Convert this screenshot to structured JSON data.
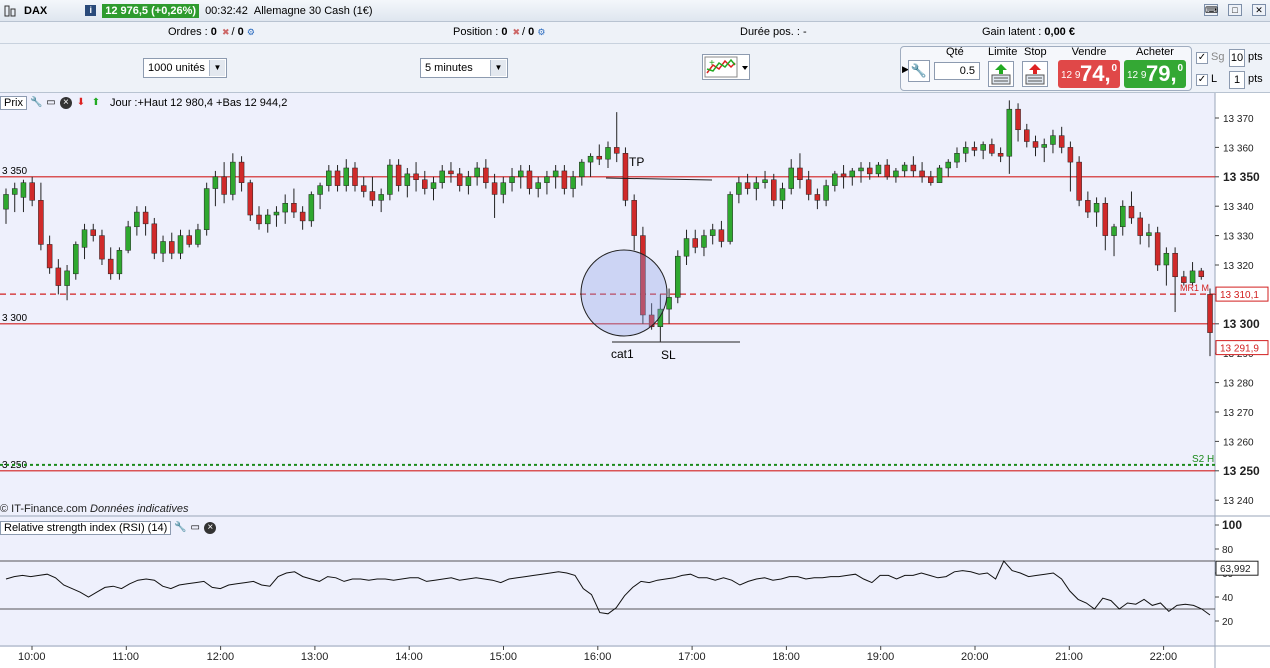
{
  "titlebar": {
    "symbol": "DAX",
    "info_icon": "i",
    "price_change": "12 976,5 (+0,26%)",
    "clock": "00:32:42",
    "instrument": "Allemagne 30 Cash (1€)",
    "buttons": [
      "keyboard-icon",
      "close-icon",
      "maximize-icon"
    ]
  },
  "status": {
    "orders_label": "Ordres :",
    "orders_count": "0",
    "orders_count2": "0",
    "position_label": "Position :",
    "position_count": "0",
    "position_count2": "0",
    "duration_label": "Durée pos. :",
    "duration_value": "-",
    "gain_label": "Gain latent :",
    "gain_value": "0,00 €"
  },
  "toolbar": {
    "units_select": "1000 unités",
    "timeframe_select": "5 minutes",
    "qty_label": "Qté",
    "qty_value": "0.5",
    "limit_label": "Limite",
    "stop_label": "Stop",
    "sell_label": "Vendre",
    "buy_label": "Acheter",
    "sell_small": "12 9",
    "sell_big": "74,",
    "sell_sup": "0",
    "buy_small": "12 9",
    "buy_big": "79,",
    "buy_sup": "0",
    "sg_label": "Sg",
    "sg_pts": "10",
    "l_label": "L",
    "l_pts": "1",
    "pts_label": "pts"
  },
  "chart_header": {
    "label": "Prix",
    "stats": "Jour :+Haut 12 980,4 +Bas 12 944,2"
  },
  "watermark": {
    "source": "© IT-Finance.com",
    "note": "Données indicatives"
  },
  "rsi_header": {
    "title": "Relative strength index (RSI) (14)"
  },
  "chart_data": [
    {
      "type": "candlestick",
      "price_axis": {
        "min": 13240,
        "max": 13370,
        "ticks": [
          "13 370",
          "13 360",
          "13 350",
          "13 340",
          "13 330",
          "13 320",
          "13 310",
          "13 300",
          "13 290",
          "13 280",
          "13 270",
          "13 260",
          "13 250",
          "13 240"
        ]
      },
      "time_axis": [
        "10:00",
        "11:00",
        "12:00",
        "13:00",
        "14:00",
        "15:00",
        "16:00",
        "17:00",
        "18:00",
        "19:00",
        "20:00",
        "21:00",
        "22:00"
      ],
      "horizontal_lines": [
        {
          "price": 13350,
          "label": "3 350",
          "style": "solid",
          "color": "#d21f1f"
        },
        {
          "price": 13300,
          "label": "3 300",
          "style": "solid",
          "color": "#d21f1f"
        },
        {
          "price": 13250,
          "label": "3 250",
          "style": "solid",
          "color": "#d21f1f"
        },
        {
          "price": 13310.1,
          "label": "",
          "style": "dashed",
          "color": "#d21f1f"
        },
        {
          "price": 13252,
          "label": "S2 H",
          "style": "dotted",
          "color": "#1b8a1b"
        }
      ],
      "axis_badges": [
        {
          "text": "13 310,1",
          "color": "#d21f1f"
        },
        {
          "text": "13 291,9",
          "color": "#d21f1f"
        }
      ],
      "bold_ticks": [
        "13 350",
        "13 300",
        "13 250"
      ],
      "annotations": [
        "TP",
        "cat1",
        "SL",
        "MR1 M"
      ],
      "candles": [
        [
          13339,
          13346,
          13334,
          13344
        ],
        [
          13344,
          13348,
          13338,
          13346
        ],
        [
          13343,
          13349,
          13338,
          13348
        ],
        [
          13348,
          13350,
          13340,
          13342
        ],
        [
          13342,
          13348,
          13325,
          13327
        ],
        [
          13327,
          13330,
          13317,
          13319
        ],
        [
          13319,
          13322,
          13310,
          13313
        ],
        [
          13313,
          13320,
          13308,
          13318
        ],
        [
          13317,
          13328,
          13315,
          13327
        ],
        [
          13326,
          13334,
          13322,
          13332
        ],
        [
          13332,
          13334,
          13328,
          13330
        ],
        [
          13330,
          13332,
          13320,
          13322
        ],
        [
          13322,
          13326,
          13315,
          13317
        ],
        [
          13317,
          13326,
          13315,
          13325
        ],
        [
          13325,
          13335,
          13324,
          13333
        ],
        [
          13333,
          13340,
          13330,
          13338
        ],
        [
          13338,
          13340,
          13330,
          13334
        ],
        [
          13334,
          13336,
          13322,
          13324
        ],
        [
          13324,
          13330,
          13321,
          13328
        ],
        [
          13328,
          13331,
          13322,
          13324
        ],
        [
          13324,
          13332,
          13322,
          13330
        ],
        [
          13330,
          13332,
          13326,
          13327
        ],
        [
          13327,
          13334,
          13326,
          13332
        ],
        [
          13332,
          13348,
          13330,
          13346
        ],
        [
          13346,
          13352,
          13340,
          13350
        ],
        [
          13350,
          13355,
          13341,
          13344
        ],
        [
          13344,
          13358,
          13342,
          13355
        ],
        [
          13355,
          13357,
          13345,
          13348
        ],
        [
          13348,
          13349,
          13335,
          13337
        ],
        [
          13337,
          13340,
          13332,
          13334
        ],
        [
          13334,
          13339,
          13331,
          13337
        ],
        [
          13337,
          13340,
          13333,
          13338
        ],
        [
          13338,
          13344,
          13334,
          13341
        ],
        [
          13341,
          13346,
          13336,
          13338
        ],
        [
          13338,
          13340,
          13332,
          13335
        ],
        [
          13335,
          13345,
          13333,
          13344
        ],
        [
          13344,
          13348,
          13339,
          13347
        ],
        [
          13347,
          13354,
          13345,
          13352
        ],
        [
          13352,
          13354,
          13345,
          13347
        ],
        [
          13347,
          13356,
          13345,
          13353
        ],
        [
          13353,
          13355,
          13345,
          13347
        ],
        [
          13347,
          13350,
          13343,
          13345
        ],
        [
          13345,
          13350,
          13340,
          13342
        ],
        [
          13342,
          13346,
          13338,
          13344
        ],
        [
          13344,
          13356,
          13342,
          13354
        ],
        [
          13354,
          13356,
          13345,
          13347
        ],
        [
          13347,
          13353,
          13343,
          13351
        ],
        [
          13351,
          13355,
          13345,
          13349
        ],
        [
          13349,
          13352,
          13344,
          13346
        ],
        [
          13346,
          13350,
          13342,
          13348
        ],
        [
          13348,
          13354,
          13346,
          13352
        ],
        [
          13352,
          13355,
          13348,
          13351
        ],
        [
          13351,
          13353,
          13345,
          13347
        ],
        [
          13347,
          13352,
          13344,
          13350
        ],
        [
          13350,
          13355,
          13347,
          13353
        ],
        [
          13353,
          13356,
          13346,
          13348
        ],
        [
          13348,
          13351,
          13336,
          13344
        ],
        [
          13344,
          13350,
          13341,
          13348
        ],
        [
          13348,
          13353,
          13345,
          13350
        ],
        [
          13350,
          13354,
          13346,
          13352
        ],
        [
          13352,
          13354,
          13344,
          13346
        ],
        [
          13346,
          13350,
          13343,
          13348
        ],
        [
          13348,
          13352,
          13344,
          13350
        ],
        [
          13350,
          13354,
          13346,
          13352
        ],
        [
          13352,
          13354,
          13344,
          13346
        ],
        [
          13346,
          13352,
          13343,
          13350
        ],
        [
          13350,
          13356,
          13347,
          13355
        ],
        [
          13355,
          13358,
          13350,
          13357
        ],
        [
          13357,
          13361,
          13354,
          13356
        ],
        [
          13356,
          13362,
          13353,
          13360
        ],
        [
          13360,
          13372,
          13355,
          13358
        ],
        [
          13358,
          13360,
          13340,
          13342
        ],
        [
          13342,
          13344,
          13325,
          13330
        ],
        [
          13330,
          13333,
          13300,
          13303
        ],
        [
          13303,
          13307,
          13298,
          13299
        ],
        [
          13299,
          13310,
          13294,
          13305
        ],
        [
          13305,
          13312,
          13300,
          13309
        ],
        [
          13309,
          13325,
          13307,
          13323
        ],
        [
          13323,
          13332,
          13320,
          13329
        ],
        [
          13329,
          13332,
          13324,
          13326
        ],
        [
          13326,
          13332,
          13323,
          13330
        ],
        [
          13330,
          13334,
          13327,
          13332
        ],
        [
          13332,
          13335,
          13326,
          13328
        ],
        [
          13328,
          13345,
          13327,
          13344
        ],
        [
          13344,
          13350,
          13341,
          13348
        ],
        [
          13348,
          13351,
          13344,
          13346
        ],
        [
          13346,
          13350,
          13342,
          13348
        ],
        [
          13348,
          13352,
          13346,
          13349
        ],
        [
          13349,
          13351,
          13340,
          13342
        ],
        [
          13342,
          13348,
          13339,
          13346
        ],
        [
          13346,
          13356,
          13344,
          13353
        ],
        [
          13353,
          13358,
          13346,
          13349
        ],
        [
          13349,
          13352,
          13342,
          13344
        ],
        [
          13344,
          13346,
          13339,
          13342
        ],
        [
          13342,
          13349,
          13340,
          13347
        ],
        [
          13347,
          13352,
          13345,
          13351
        ],
        [
          13351,
          13354,
          13346,
          13350
        ],
        [
          13350,
          13353,
          13347,
          13352
        ],
        [
          13352,
          13355,
          13348,
          13353
        ],
        [
          13353,
          13355,
          13349,
          13351
        ],
        [
          13351,
          13355,
          13350,
          13354
        ],
        [
          13354,
          13356,
          13349,
          13350
        ],
        [
          13350,
          13353,
          13348,
          13352
        ],
        [
          13352,
          13355,
          13350,
          13354
        ],
        [
          13354,
          13357,
          13350,
          13352
        ],
        [
          13352,
          13355,
          13348,
          13350
        ],
        [
          13350,
          13352,
          13347,
          13348
        ],
        [
          13348,
          13354,
          13348,
          13353
        ],
        [
          13353,
          13356,
          13350,
          13355
        ],
        [
          13355,
          13360,
          13353,
          13358
        ],
        [
          13358,
          13362,
          13355,
          13360
        ],
        [
          13360,
          13362,
          13357,
          13359
        ],
        [
          13359,
          13362,
          13356,
          13361
        ],
        [
          13361,
          13363,
          13357,
          13358
        ],
        [
          13358,
          13360,
          13355,
          13357
        ],
        [
          13357,
          13376,
          13351,
          13373
        ],
        [
          13373,
          13375,
          13362,
          13366
        ],
        [
          13366,
          13368,
          13360,
          13362
        ],
        [
          13362,
          13364,
          13357,
          13360
        ],
        [
          13360,
          13363,
          13355,
          13361
        ],
        [
          13361,
          13366,
          13358,
          13364
        ],
        [
          13364,
          13367,
          13358,
          13360
        ],
        [
          13360,
          13362,
          13345,
          13355
        ],
        [
          13355,
          13357,
          13340,
          13342
        ],
        [
          13342,
          13345,
          13336,
          13338
        ],
        [
          13338,
          13343,
          13333,
          13341
        ],
        [
          13341,
          13343,
          13325,
          13330
        ],
        [
          13330,
          13334,
          13323,
          13333
        ],
        [
          13333,
          13342,
          13330,
          13340
        ],
        [
          13340,
          13345,
          13334,
          13336
        ],
        [
          13336,
          13338,
          13327,
          13330
        ],
        [
          13330,
          13334,
          13326,
          13331
        ],
        [
          13331,
          13333,
          13318,
          13320
        ],
        [
          13320,
          13326,
          13313,
          13324
        ],
        [
          13324,
          13326,
          13304,
          13316
        ],
        [
          13316,
          13318,
          13313,
          13314
        ],
        [
          13314,
          13321,
          13313,
          13318
        ],
        [
          13318,
          13319,
          13315,
          13316
        ],
        [
          13310,
          13312,
          13289,
          13297
        ]
      ]
    },
    {
      "type": "line",
      "name": "Relative strength index (RSI) (14)",
      "y_axis": {
        "min": 0,
        "max": 100,
        "ticks": [
          "100",
          "80",
          "60",
          "40",
          "20"
        ]
      },
      "reference_lines": [
        70,
        30
      ],
      "last_value_badge": "63,992",
      "values": [
        55,
        57,
        58,
        57,
        58,
        59,
        56,
        50,
        47,
        44,
        40,
        44,
        48,
        49,
        47,
        51,
        54,
        55,
        54,
        49,
        47,
        50,
        51,
        52,
        53,
        48,
        47,
        50,
        51,
        52,
        53,
        50,
        49,
        57,
        60,
        61,
        57,
        55,
        53,
        57,
        56,
        53,
        55,
        55,
        54,
        55,
        55,
        54,
        55,
        56,
        56,
        53,
        54,
        55,
        56,
        54,
        55,
        56,
        55,
        54,
        52,
        55,
        56,
        57,
        58,
        59,
        60,
        61,
        60,
        58,
        47,
        42,
        27,
        26,
        31,
        41,
        48,
        53,
        52,
        54,
        55,
        56,
        58,
        59,
        56,
        56,
        54,
        56,
        54,
        50,
        53,
        55,
        56,
        54,
        55,
        57,
        57,
        55,
        56,
        56,
        57,
        57,
        58,
        59,
        55,
        52,
        58,
        58,
        55,
        58,
        58,
        60,
        58,
        56,
        57,
        61,
        62,
        61,
        59,
        60,
        55,
        70,
        62,
        60,
        57,
        58,
        59,
        60,
        55,
        45,
        38,
        35,
        30,
        39,
        37,
        30,
        35,
        34,
        38,
        33,
        35,
        28,
        33,
        34,
        33,
        30,
        25
      ]
    }
  ]
}
